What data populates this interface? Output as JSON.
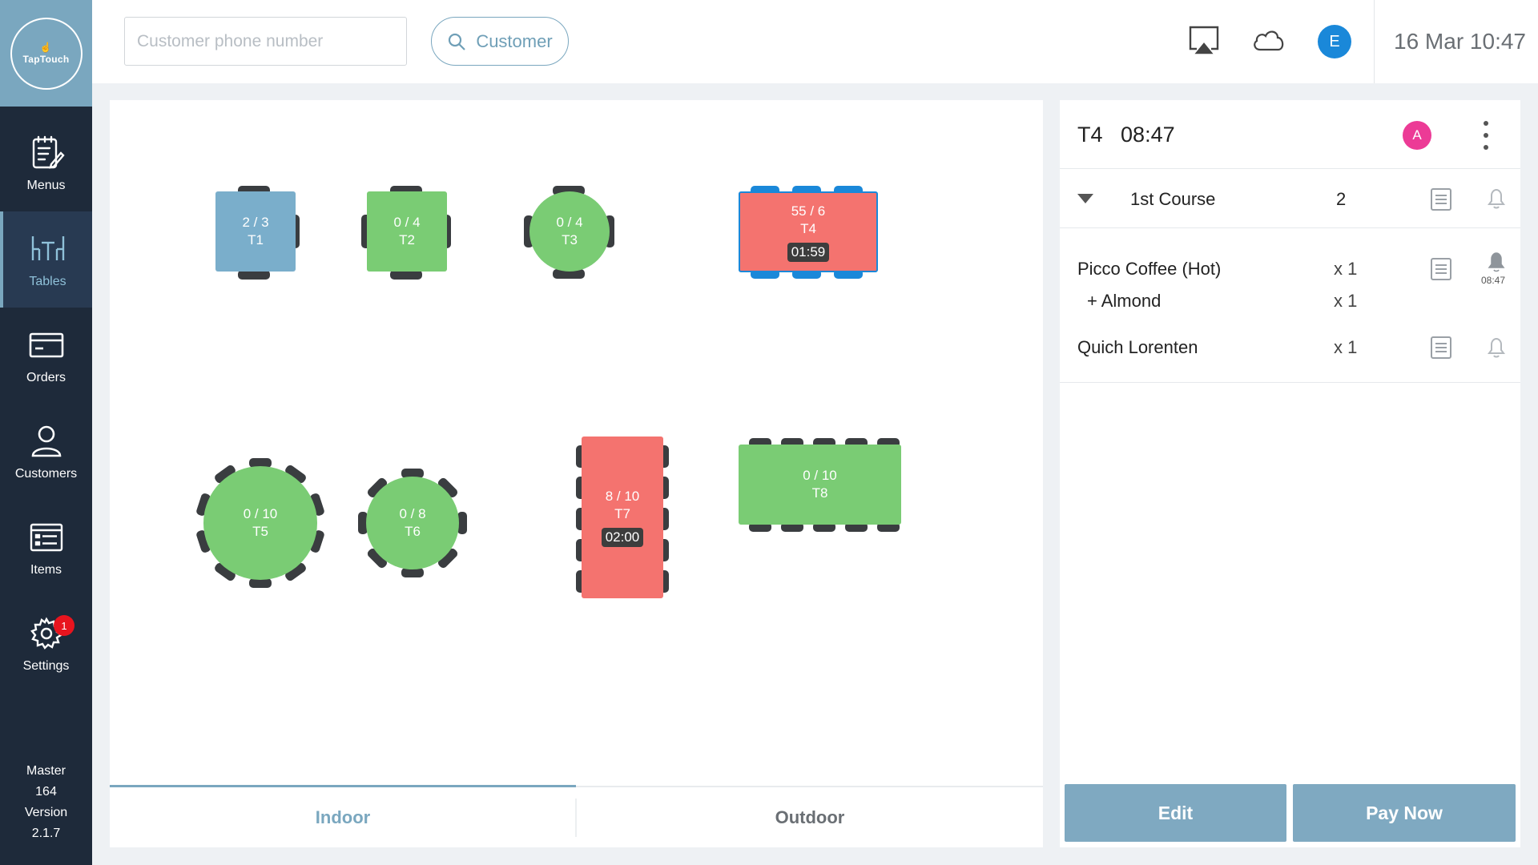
{
  "app": {
    "logo_text": "TapTouch"
  },
  "sidebar": {
    "items": [
      {
        "label": "Menus",
        "icon": "menu-notepad-icon",
        "active": false
      },
      {
        "label": "Tables",
        "icon": "tables-icon",
        "active": true
      },
      {
        "label": "Orders",
        "icon": "card-icon",
        "active": false
      },
      {
        "label": "Customers",
        "icon": "person-icon",
        "active": false
      },
      {
        "label": "Items",
        "icon": "list-icon",
        "active": false
      },
      {
        "label": "Settings",
        "icon": "gear-icon",
        "active": false,
        "badge": "1"
      }
    ],
    "version": {
      "line1": "Master",
      "line2": "164",
      "line3": "Version",
      "line4": "2.1.7"
    }
  },
  "header": {
    "phone_placeholder": "Customer phone number",
    "customer_button": "Customer",
    "avatar_initial": "E",
    "datetime": "16 Mar 10:47"
  },
  "floor": {
    "tables": [
      {
        "id": "T1",
        "occupancy": "2 / 3",
        "status": "seated",
        "color": "#7aaecb",
        "timer": ""
      },
      {
        "id": "T2",
        "occupancy": "0 / 4",
        "status": "free",
        "color": "#7acc74",
        "timer": ""
      },
      {
        "id": "T3",
        "occupancy": "0 / 4",
        "status": "free",
        "color": "#7acc74",
        "timer": ""
      },
      {
        "id": "T4",
        "occupancy": "55 / 6",
        "status": "busy",
        "color": "#f4736f",
        "timer": "01:59"
      },
      {
        "id": "T5",
        "occupancy": "0 / 10",
        "status": "free",
        "color": "#7acc74",
        "timer": ""
      },
      {
        "id": "T6",
        "occupancy": "0 / 8",
        "status": "free",
        "color": "#7acc74",
        "timer": ""
      },
      {
        "id": "T7",
        "occupancy": "8 / 10",
        "status": "busy",
        "color": "#f4736f",
        "timer": "02:00"
      },
      {
        "id": "T8",
        "occupancy": "0 / 10",
        "status": "free",
        "color": "#7acc74",
        "timer": ""
      }
    ],
    "tabs": [
      {
        "label": "Indoor",
        "active": true
      },
      {
        "label": "Outdoor",
        "active": false
      }
    ]
  },
  "order": {
    "table": "T4",
    "time": "08:47",
    "avatar_initial": "A",
    "course": {
      "name": "1st Course",
      "count": "2"
    },
    "items": [
      {
        "name": "Picco Coffee (Hot)",
        "qty": "x 1",
        "bell_time": "08:47"
      },
      {
        "name": "+ Almond",
        "qty": "x 1",
        "modifier": true
      },
      {
        "name": "Quich Lorenten",
        "qty": "x 1"
      }
    ],
    "edit_label": "Edit",
    "pay_label": "Pay Now"
  }
}
